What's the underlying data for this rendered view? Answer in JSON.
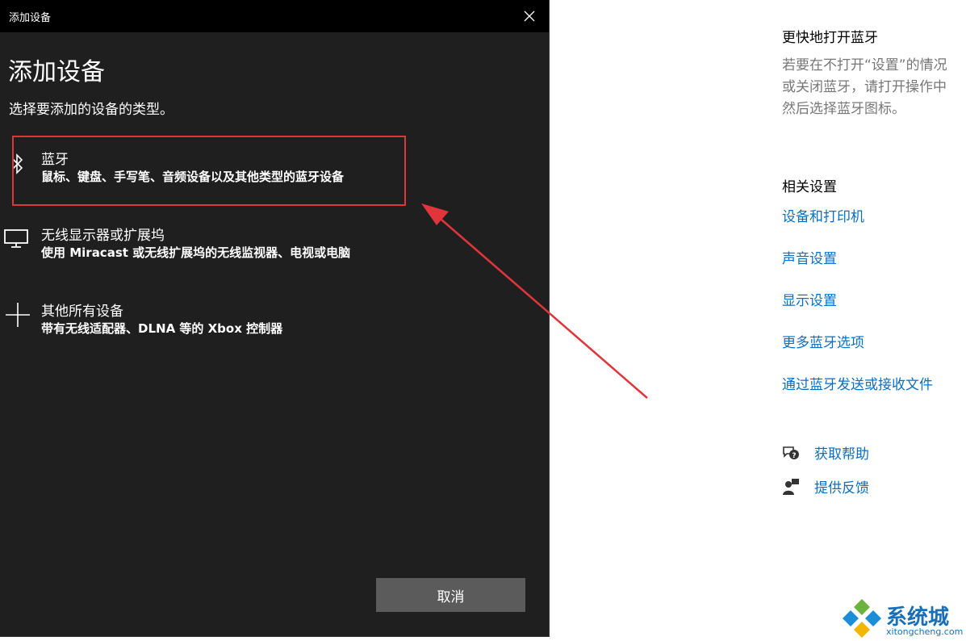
{
  "dialog": {
    "window_title": "添加设备",
    "heading": "添加设备",
    "subheading": "选择要添加的设备的类型。",
    "devices": [
      {
        "icon": "bluetooth-icon",
        "name": "蓝牙",
        "desc": "鼠标、键盘、手写笔、音频设备以及其他类型的蓝牙设备"
      },
      {
        "icon": "monitor-icon",
        "name": "无线显示器或扩展坞",
        "desc": "使用 Miracast 或无线扩展坞的无线监视器、电视或电脑"
      },
      {
        "icon": "plus-icon",
        "name": "其他所有设备",
        "desc": "带有无线适配器、DLNA 等的 Xbox 控制器"
      }
    ],
    "cancel_label": "取消"
  },
  "panel": {
    "quick_heading": "更快地打开蓝牙",
    "quick_lines": [
      "若要在不打开“设置”的情况",
      "或关闭蓝牙，请打开操作中",
      "然后选择蓝牙图标。"
    ],
    "related_heading": "相关设置",
    "links": [
      "设备和打印机",
      "声音设置",
      "显示设置",
      "更多蓝牙选项",
      "通过蓝牙发送或接收文件"
    ],
    "help_label": "获取帮助",
    "feedback_label": "提供反馈"
  },
  "watermark": {
    "brand": "系统城",
    "domain": "xitongcheng.com"
  },
  "colors": {
    "dialog_bg": "#1f1f1f",
    "titlebar_bg": "#000000",
    "highlight": "#e0353b",
    "link": "#0a6fc2",
    "button_bg": "#5b5b5b"
  }
}
